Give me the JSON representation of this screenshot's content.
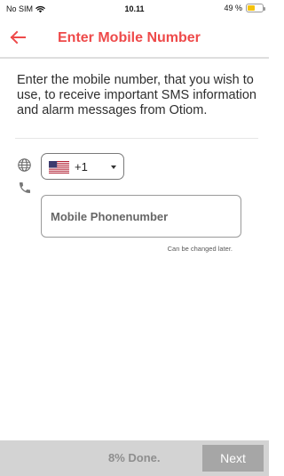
{
  "status_bar": {
    "carrier": "No SIM",
    "time": "10.11",
    "battery_text": "49 %",
    "battery_level": 0.49,
    "battery_color": "#f4c20d",
    "wifi_icon": "wifi-icon"
  },
  "header": {
    "title": "Enter Mobile Number",
    "back_icon": "back-arrow-icon",
    "accent_color": "#ee4a4a"
  },
  "intro_text": "Enter the mobile number, that you wish to use, to receive important SMS information and alarm messages from Otiom.",
  "country": {
    "icon": "globe-icon",
    "flag": "us-flag",
    "dial_code": "+1"
  },
  "phone": {
    "icon": "phone-icon",
    "placeholder": "Mobile Phonenumber",
    "value": "",
    "helper": "Can be changed later."
  },
  "footer": {
    "progress_text": "8% Done.",
    "next_label": "Next"
  }
}
